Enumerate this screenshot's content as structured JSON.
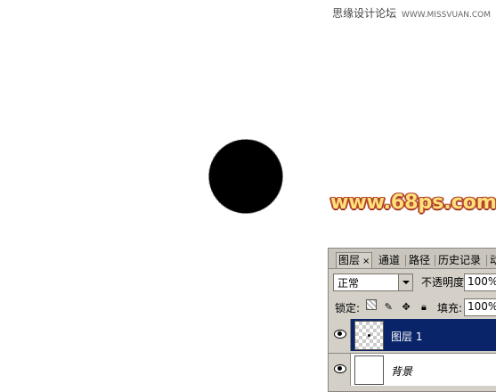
{
  "watermark": {
    "site_name": "思缘设计论坛",
    "url": "WWW.MISSVUAN.COM"
  },
  "site_mark": "www.68ps.com",
  "layers_panel": {
    "tabs": [
      {
        "label": "图层",
        "close": "×"
      },
      {
        "label": "通道"
      },
      {
        "label": "路径"
      },
      {
        "label": "历史记录"
      },
      {
        "label": "动"
      }
    ],
    "blend_mode": "正常",
    "opacity_label": "不透明度:",
    "opacity_value": "100%",
    "lock_label": "锁定:",
    "fill_label": "填充:",
    "fill_value": "100%",
    "layers": [
      {
        "name": "图层 1",
        "selected": true
      },
      {
        "name": "背景",
        "selected": false
      }
    ]
  },
  "colors": {
    "selection": "#0a246a",
    "panel_bg": "#d4d0c8",
    "dot": "#000000"
  }
}
